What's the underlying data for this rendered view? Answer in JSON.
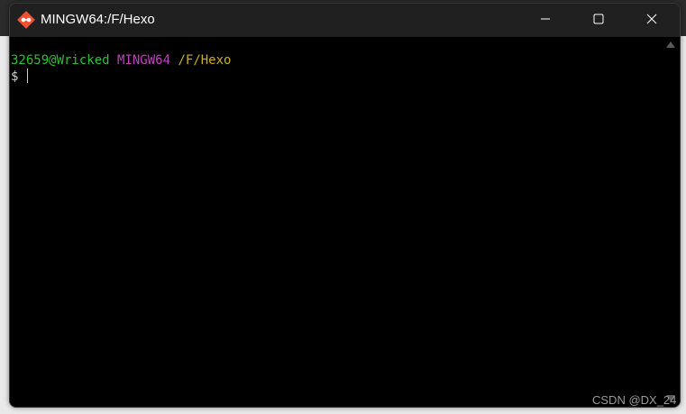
{
  "window": {
    "title": "MINGW64:/F/Hexo",
    "icon": "git-bash-icon"
  },
  "terminal": {
    "user_host": "32659@Wricked",
    "system": "MINGW64",
    "path": "/F/Hexo",
    "prompt": "$",
    "colors": {
      "background": "#000000",
      "user_host": "#2fbf2f",
      "system": "#c040c0",
      "path": "#c8b020"
    }
  },
  "watermark": "CSDN @DX_24"
}
